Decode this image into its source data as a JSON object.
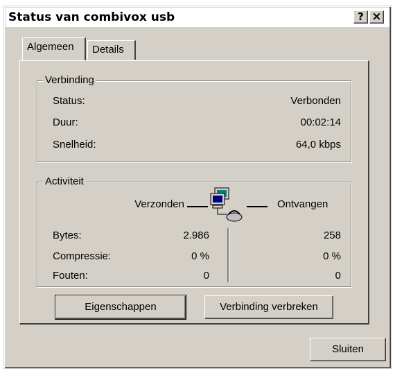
{
  "window": {
    "title": "Status van combivox usb",
    "help_button": "?",
    "close_button": "×"
  },
  "tabs": [
    {
      "label": "Algemeen",
      "active": true
    },
    {
      "label": "Details",
      "active": false
    }
  ],
  "connection": {
    "legend": "Verbinding",
    "rows": [
      {
        "label": "Status:",
        "value": "Verbonden"
      },
      {
        "label": "Duur:",
        "value": "00:02:14"
      },
      {
        "label": "Snelheid:",
        "value": "64,0 kbps"
      }
    ]
  },
  "activity": {
    "legend": "Activiteit",
    "sent_label": "Verzonden",
    "received_label": "Ontvangen",
    "icon": "network-computers-icon",
    "rows": [
      {
        "label": "Bytes:",
        "sent": "2.986",
        "received": "258"
      },
      {
        "label": "Compressie:",
        "sent": "0 %",
        "received": "0 %"
      },
      {
        "label": "Fouten:",
        "sent": "0",
        "received": "0"
      }
    ]
  },
  "buttons": {
    "properties": "Eigenschappen",
    "disconnect": "Verbinding verbreken",
    "close": "Sluiten"
  }
}
